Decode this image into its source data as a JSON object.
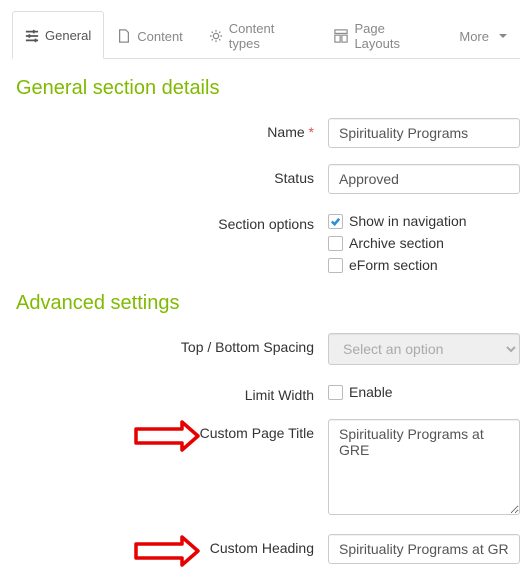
{
  "tabs": {
    "general": "General",
    "content": "Content",
    "content_types": "Content types",
    "page_layouts": "Page Layouts",
    "more": "More"
  },
  "headings": {
    "general_details": "General section details",
    "advanced": "Advanced settings"
  },
  "labels": {
    "name": "Name",
    "status": "Status",
    "section_options": "Section options",
    "top_bottom_spacing": "Top / Bottom Spacing",
    "limit_width": "Limit Width",
    "custom_page_title": "Custom Page Title",
    "custom_heading": "Custom Heading"
  },
  "values": {
    "name": "Spirituality Programs",
    "status": "Approved",
    "spacing_placeholder": "Select an option",
    "custom_page_title": "Spirituality Programs at GRE",
    "custom_heading": "Spirituality Programs at GRE"
  },
  "opts": {
    "show_nav": "Show in navigation",
    "archive": "Archive section",
    "eform": "eForm section",
    "enable": "Enable"
  },
  "checks": {
    "show_nav": true,
    "archive": false,
    "eform": false,
    "enable": false
  }
}
